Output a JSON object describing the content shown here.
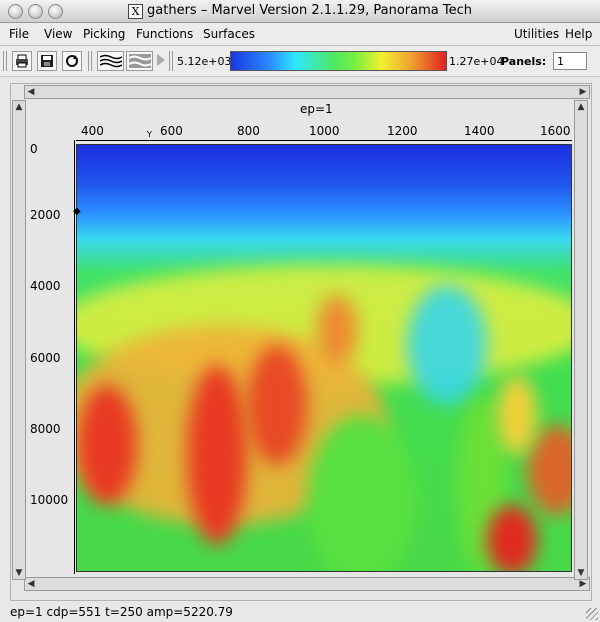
{
  "window": {
    "title": "gathers – Marvel Version 2.1.1.29, Panorama Tech",
    "x_glyph": "X"
  },
  "menu": {
    "left": [
      "File",
      "View",
      "Picking",
      "Functions",
      "Surfaces"
    ],
    "right": [
      "Utilities",
      "Help"
    ]
  },
  "toolbar": {
    "icons": [
      "print-icon",
      "save-icon",
      "refresh-icon",
      "wiggle-display-icon",
      "variable-density-icon",
      "arrow-right-icon"
    ],
    "colorbar_min": "5.12e+03",
    "colorbar_max": "1.27e+04",
    "panels_label": "Panels:",
    "panels_value": "1"
  },
  "plot": {
    "title": "ep=1",
    "x_ticks": [
      "400",
      "600",
      "800",
      "1000",
      "1200",
      "1400",
      "1600"
    ],
    "y_ticks": [
      "0",
      "2000",
      "4000",
      "6000",
      "8000",
      "10000"
    ]
  },
  "status_bar": {
    "text": "ep=1   cdp=551  t=250  amp=5220.79"
  }
}
